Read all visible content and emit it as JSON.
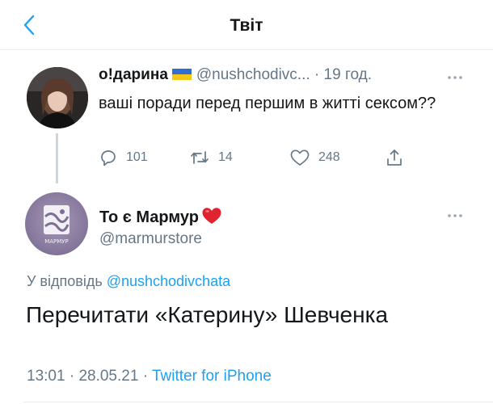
{
  "header": {
    "title": "Твіт"
  },
  "original_tweet": {
    "display_name": "о!дарина",
    "flag_icon": "ukraine-flag-icon",
    "handle": "@nushchodivc...",
    "separator": "·",
    "time": "19 год.",
    "text": "ваші поради перед першим в житті сексом??",
    "stats": {
      "replies": "101",
      "retweets": "14",
      "likes": "248"
    }
  },
  "reply_tweet": {
    "display_name": "То є Мармур",
    "name_emoji": "red-heart-icon",
    "handle": "@marmurstore",
    "avatar_label": "МАРМУР",
    "replying_prefix": "У відповідь",
    "replying_to": "@nushchodivchata",
    "text": "Перечитати «Катерину» Шевченка",
    "time": "13:01",
    "sep1": "·",
    "date": "28.05.21",
    "sep2": "·",
    "source": "Twitter for iPhone"
  },
  "colors": {
    "accent": "#1da1f2",
    "secondary_text": "#657786",
    "primary_text": "#14171a",
    "avatar_brand": "#8a7aa0"
  }
}
